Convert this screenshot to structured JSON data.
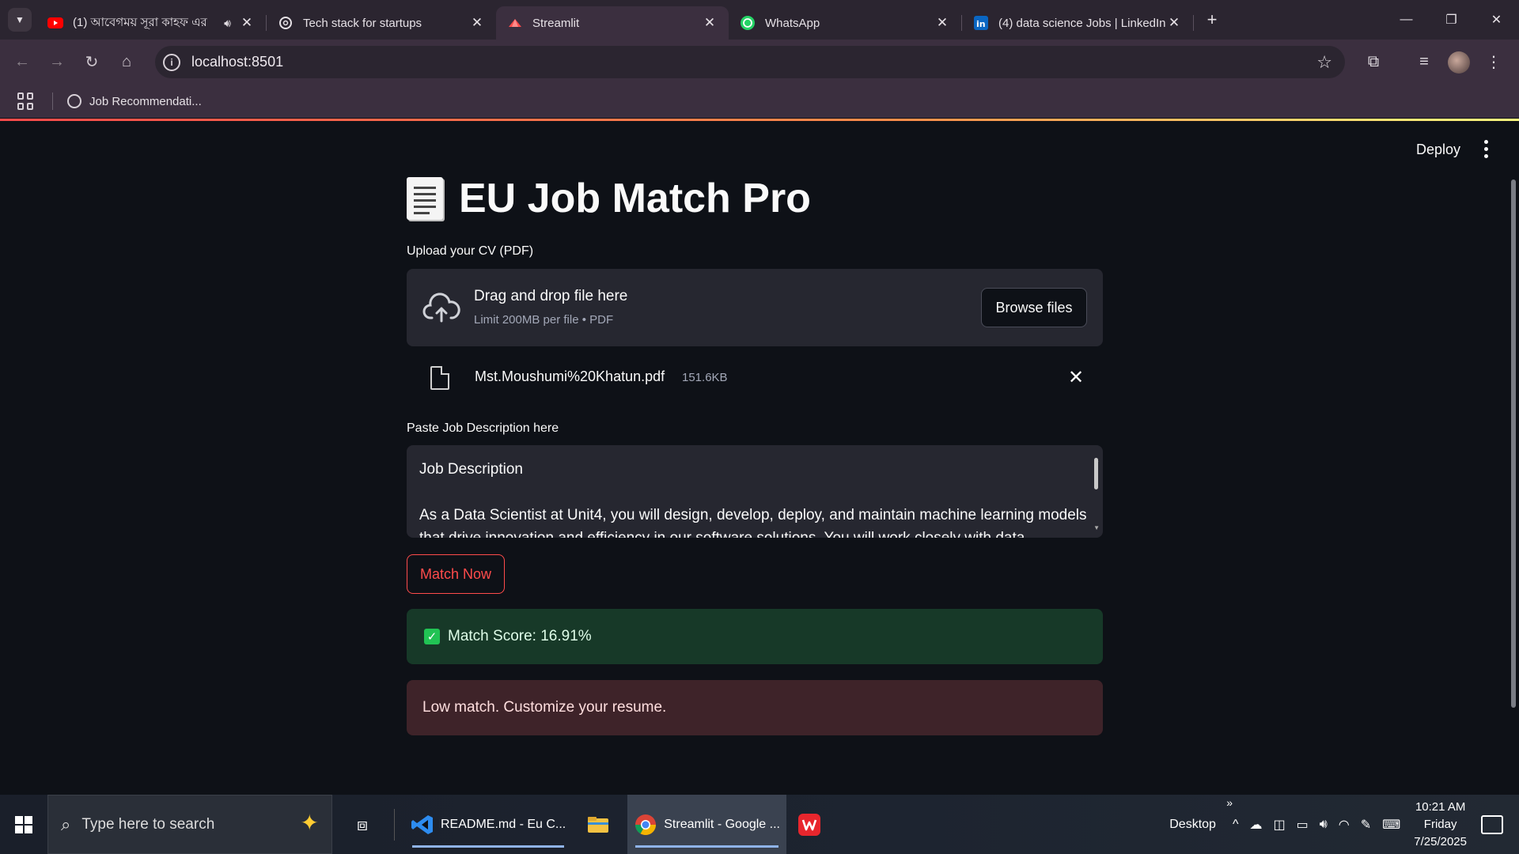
{
  "browser": {
    "tabs": [
      {
        "title": "(1) আবেগময় সূরা কাহফ এর",
        "icon": "youtube-icon",
        "audio": true,
        "active": false
      },
      {
        "title": "Tech stack for startups",
        "icon": "openai-icon",
        "audio": false,
        "active": false
      },
      {
        "title": "Streamlit",
        "icon": "streamlit-icon",
        "audio": false,
        "active": true
      },
      {
        "title": "WhatsApp",
        "icon": "whatsapp-icon",
        "audio": false,
        "active": false
      },
      {
        "title": "(4) data science Jobs | LinkedIn",
        "icon": "linkedin-icon",
        "audio": false,
        "active": false
      }
    ],
    "url": "localhost:8501",
    "bookmark": "Job Recommendati..."
  },
  "app": {
    "deploy_label": "Deploy",
    "title": "EU Job Match Pro",
    "upload": {
      "label": "Upload your CV (PDF)",
      "drop_text": "Drag and drop file here",
      "limit_text": "Limit 200MB per file • PDF",
      "browse_label": "Browse files"
    },
    "file": {
      "name": "Mst.Moushumi%20Khatun.pdf",
      "size": "151.6KB"
    },
    "job_description": {
      "label": "Paste Job Description here",
      "line1": "Job Description",
      "line2": "",
      "line3": "As a Data Scientist at Unit4, you will design, develop, deploy, and maintain machine learning models",
      "line4": "that drive innovation and efficiency in our software solutions. You will work closely with data"
    },
    "match_button": "Match Now",
    "score_text": "Match Score: 16.91%",
    "advice_text": "Low match. Customize your resume."
  },
  "taskbar": {
    "search_placeholder": "Type here to search",
    "apps": [
      {
        "label": "README.md - Eu C...",
        "icon": "vscode-icon"
      },
      {
        "label": "",
        "icon": "file-explorer-icon"
      },
      {
        "label": "Streamlit - Google ...",
        "icon": "chrome-icon"
      },
      {
        "label": "",
        "icon": "wps-icon"
      }
    ],
    "desktop_label": "Desktop",
    "time": "10:21 AM",
    "day": "Friday",
    "date": "7/25/2025"
  },
  "colors": {
    "accent": "#ff4b4b",
    "success_bg": "#173928",
    "error_bg": "#3e2329",
    "app_bg": "#0e1117"
  }
}
